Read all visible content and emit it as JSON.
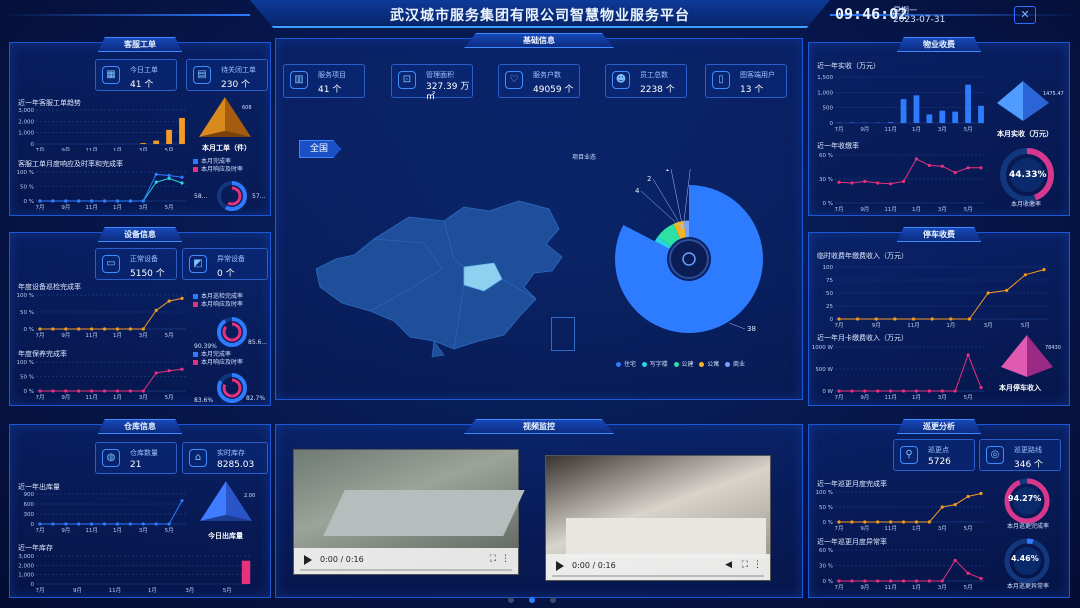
{
  "header": {
    "title": "武汉城市服务集团有限公司智慧物业服务平台",
    "clock": "09:46:02",
    "weekday": "星期一",
    "date": "2023-07-31"
  },
  "colors": {
    "accent": "#2d7bff",
    "orange": "#f59a23",
    "pink": "#e8317d",
    "cyan": "#29d5e0"
  },
  "service_orders": {
    "title": "客服工单",
    "today_label": "今日工单",
    "today_value": "41 个",
    "pending_label": "待关闭工单",
    "pending_value": "230 个",
    "trend_title": "近一年客服工单趋势",
    "rate_title": "客服工单月度响应及时率和完成率",
    "legend_done": "本月完成率",
    "legend_resp": "本月响应及时率",
    "pyramid_value": "608",
    "pyramid_label": "本月工单（件）",
    "donut_left": "58...",
    "donut_right": "57..."
  },
  "devices": {
    "title": "设备信息",
    "normal_label": "正常设备",
    "normal_value": "5150 个",
    "abnormal_label": "异常设备",
    "abnormal_value": "0 个",
    "inspect_title": "年度设备巡检完成率",
    "maintain_title": "年度保养完成率",
    "legend_inspect": "本月巡检完成率",
    "legend_inspect_resp": "本月响应及时率",
    "legend_maint": "本月完成率",
    "legend_maint_resp": "本月响应及时率",
    "donut1_left": "90.39%",
    "donut1_right": "85.6...",
    "donut2_left": "83.6%",
    "donut2_right": "82.7%"
  },
  "warehouse": {
    "title": "仓库信息",
    "count_label": "仓库数量",
    "count_value": "21",
    "stock_label": "实时库存",
    "stock_value": "8285.03",
    "out_title": "近一年出库量",
    "stock_title": "近一年库存",
    "pyramid_value": "2.00",
    "pyramid_label": "今日出库量"
  },
  "base_info": {
    "title": "基础信息",
    "cards": [
      {
        "label": "服务项目",
        "value": "41 个",
        "icon": "building-icon"
      },
      {
        "label": "管理面积",
        "value": "327.39 万 ㎡",
        "icon": "area-icon"
      },
      {
        "label": "服务户数",
        "value": "49059 个",
        "icon": "heart-icon"
      },
      {
        "label": "员工总数",
        "value": "2238 个",
        "icon": "people-icon"
      },
      {
        "label": "图客端用户",
        "value": "13 个",
        "icon": "phone-icon"
      }
    ],
    "map_button": "全国",
    "pie_title": "项目业态",
    "pie_legend": [
      "住宅",
      "写字楼",
      "公建",
      "公寓",
      "商业"
    ],
    "pie_callouts": [
      "1",
      "2",
      "4",
      "1",
      "38"
    ]
  },
  "video": {
    "title": "视频监控",
    "time": "0:00 / 0:16"
  },
  "property_fee": {
    "title": "物业收费",
    "collected_title": "近一年实收（万元）",
    "rate_title": "近一年收缴率",
    "pyramid_value": "1475.47",
    "pyramid_label": "本月实收（万元）",
    "gauge_value": "44.33%",
    "gauge_label": "本月收缴率"
  },
  "parking": {
    "title": "停车收费",
    "temp_title": "临时收费年缴费收入（万元）",
    "card_title": "近一年月卡缴费收入（万元）",
    "pyramid_value": "78430",
    "pyramid_label": "本月停车收入"
  },
  "patrol": {
    "title": "巡更分析",
    "points_label": "巡更点",
    "points_value": "5726",
    "routes_label": "巡更路线",
    "routes_value": "346 个",
    "done_title": "近一年巡更月度完成率",
    "abnormal_title": "近一年巡更月度异常率",
    "gauge1_value": "94.27%",
    "gauge1_label": "本月巡更完成率",
    "gauge2_value": "4.46%",
    "gauge2_label": "本月巡更异常率"
  },
  "chart_data": [
    {
      "type": "bar",
      "title": "近一年客服工单趋势",
      "categories": [
        "7月",
        "8月",
        "9月",
        "10月",
        "11月",
        "12月",
        "1月",
        "2月",
        "3月",
        "4月",
        "5月",
        "6月"
      ],
      "values": [
        0,
        0,
        0,
        0,
        0,
        0,
        0,
        0,
        80,
        300,
        1250,
        2300
      ],
      "ylim": [
        0,
        3000
      ],
      "yticks": [
        "0",
        "1,000",
        "2,000",
        "3,000"
      ],
      "xticks": [
        "7月",
        "9月",
        "11月",
        "1月",
        "3月",
        "5月"
      ]
    },
    {
      "type": "line",
      "title": "客服工单月度响应及时率和完成率",
      "categories": [
        "7月",
        "8月",
        "9月",
        "10月",
        "11月",
        "12月",
        "1月",
        "2月",
        "3月",
        "4月",
        "5月",
        "6月"
      ],
      "series": [
        {
          "name": "本月完成率",
          "values": [
            0,
            0,
            0,
            0,
            0,
            0,
            0,
            0,
            0,
            65,
            78,
            62
          ]
        },
        {
          "name": "本月响应及时率",
          "values": [
            0,
            0,
            0,
            0,
            0,
            0,
            0,
            0,
            0,
            92,
            88,
            82
          ]
        }
      ],
      "ylim": [
        0,
        100
      ],
      "yticks": [
        "0 %",
        "50 %",
        "100 %"
      ],
      "xticks": [
        "7月",
        "9月",
        "11月",
        "1月",
        "3月",
        "5月"
      ]
    },
    {
      "type": "line",
      "title": "年度设备巡检完成率",
      "categories": [
        "7月",
        "8月",
        "9月",
        "10月",
        "11月",
        "12月",
        "1月",
        "2月",
        "3月",
        "4月",
        "5月",
        "6月"
      ],
      "series": [
        {
          "name": "本月巡检完成率",
          "values": [
            0,
            0,
            0,
            0,
            0,
            0,
            0,
            0,
            0,
            55,
            82,
            90
          ]
        }
      ],
      "ylim": [
        0,
        100
      ],
      "yticks": [
        "0 %",
        "50 %",
        "100 %"
      ],
      "xticks": [
        "7月",
        "9月",
        "11月",
        "1月",
        "3月",
        "5月"
      ]
    },
    {
      "type": "line",
      "title": "年度保养完成率",
      "categories": [
        "7月",
        "8月",
        "9月",
        "10月",
        "11月",
        "12月",
        "1月",
        "2月",
        "3月",
        "4月",
        "5月",
        "6月"
      ],
      "series": [
        {
          "name": "本月完成率",
          "values": [
            0,
            0,
            0,
            0,
            0,
            0,
            0,
            0,
            0,
            62,
            70,
            75
          ]
        }
      ],
      "ylim": [
        0,
        100
      ],
      "yticks": [
        "0 %",
        "50 %",
        "100 %"
      ],
      "xticks": [
        "7月",
        "9月",
        "11月",
        "1月",
        "3月",
        "5月"
      ]
    },
    {
      "type": "line",
      "title": "近一年出库量",
      "categories": [
        "7月",
        "8月",
        "9月",
        "10月",
        "11月",
        "12月",
        "1月",
        "2月",
        "3月",
        "4月",
        "5月",
        "6月"
      ],
      "series": [
        {
          "name": "出库量",
          "values": [
            0,
            0,
            0,
            0,
            0,
            0,
            0,
            0,
            0,
            0,
            0,
            700
          ]
        }
      ],
      "ylim": [
        0,
        900
      ],
      "yticks": [
        "0",
        "300",
        "600",
        "900"
      ],
      "xticks": [
        "7月",
        "9月",
        "11月",
        "1月",
        "3月",
        "5月"
      ]
    },
    {
      "type": "bar",
      "title": "近一年库存",
      "categories": [
        "7月",
        "8月",
        "9月",
        "10月",
        "11月",
        "12月",
        "1月",
        "2月",
        "3月",
        "4月",
        "5月",
        "6月"
      ],
      "values": [
        0,
        0,
        0,
        0,
        0,
        0,
        0,
        0,
        0,
        0,
        0,
        2500
      ],
      "ylim": [
        0,
        3000
      ],
      "yticks": [
        "0",
        "1,000",
        "2,000",
        "3,000"
      ],
      "xticks": [
        "7月",
        "9月",
        "11月",
        "1月",
        "3月",
        "5月"
      ]
    },
    {
      "type": "pie",
      "title": "项目业态",
      "categories": [
        "住宅",
        "写字楼",
        "公建",
        "公寓",
        "商业"
      ],
      "values": [
        38,
        1,
        4,
        2,
        1
      ]
    },
    {
      "type": "bar",
      "title": "近一年实收（万元）",
      "categories": [
        "7月",
        "8月",
        "9月",
        "10月",
        "11月",
        "12月",
        "1月",
        "2月",
        "3月",
        "4月",
        "5月",
        "6月"
      ],
      "values": [
        10,
        15,
        10,
        12,
        25,
        780,
        900,
        280,
        400,
        370,
        1250,
        560
      ],
      "ylim": [
        0,
        1500
      ],
      "yticks": [
        "0",
        "500",
        "1,000",
        "1,500"
      ],
      "xticks": [
        "7月",
        "9月",
        "11月",
        "1月",
        "3月",
        "5月"
      ]
    },
    {
      "type": "line",
      "title": "近一年收缴率",
      "categories": [
        "7月",
        "8月",
        "9月",
        "10月",
        "11月",
        "12月",
        "1月",
        "2月",
        "3月",
        "4月",
        "5月",
        "6月"
      ],
      "series": [
        {
          "name": "收缴率",
          "values": [
            26,
            25,
            27,
            25,
            24,
            27,
            55,
            47,
            46,
            38,
            44,
            44
          ]
        }
      ],
      "ylim": [
        0,
        60
      ],
      "yticks": [
        "0 %",
        "30 %",
        "60 %"
      ],
      "xticks": [
        "7月",
        "9月",
        "11月",
        "1月",
        "3月",
        "5月"
      ]
    },
    {
      "type": "line",
      "title": "临时收费年缴费收入（万元）",
      "categories": [
        "7月",
        "8月",
        "9月",
        "10月",
        "11月",
        "12月",
        "1月",
        "2月",
        "3月",
        "4月",
        "5月",
        "6月"
      ],
      "series": [
        {
          "name": "临时收费",
          "values": [
            0,
            0,
            0,
            0,
            0,
            0,
            0,
            0,
            50,
            55,
            85,
            95
          ]
        }
      ],
      "ylim": [
        0,
        100
      ],
      "yticks": [
        "0",
        "25",
        "50",
        "75",
        "100"
      ],
      "xticks": [
        "7月",
        "9月",
        "11月",
        "1月",
        "3月",
        "5月"
      ]
    },
    {
      "type": "line",
      "title": "近一年月卡缴费收入（万元）",
      "categories": [
        "7月",
        "8月",
        "9月",
        "10月",
        "11月",
        "12月",
        "1月",
        "2月",
        "3月",
        "4月",
        "5月",
        "6月"
      ],
      "series": [
        {
          "name": "月卡",
          "values": [
            0,
            0,
            0,
            0,
            0,
            0,
            0,
            0,
            0,
            0,
            820,
            80
          ]
        }
      ],
      "ylim": [
        0,
        1000
      ],
      "yticks": [
        "0 W",
        "500 W",
        "1000 W"
      ],
      "xticks": [
        "7月",
        "9月",
        "11月",
        "1月",
        "3月",
        "5月"
      ]
    },
    {
      "type": "line",
      "title": "近一年巡更月度完成率",
      "categories": [
        "7月",
        "8月",
        "9月",
        "10月",
        "11月",
        "12月",
        "1月",
        "2月",
        "3月",
        "4月",
        "5月",
        "6月"
      ],
      "series": [
        {
          "name": "完成率",
          "values": [
            0,
            0,
            0,
            0,
            0,
            0,
            0,
            0,
            50,
            58,
            85,
            95
          ]
        }
      ],
      "ylim": [
        0,
        100
      ],
      "yticks": [
        "0 %",
        "50 %",
        "100 %"
      ],
      "xticks": [
        "7月",
        "9月",
        "11月",
        "1月",
        "3月",
        "5月"
      ]
    },
    {
      "type": "line",
      "title": "近一年巡更月度异常率",
      "categories": [
        "7月",
        "8月",
        "9月",
        "10月",
        "11月",
        "12月",
        "1月",
        "2月",
        "3月",
        "4月",
        "5月",
        "6月"
      ],
      "series": [
        {
          "name": "异常率",
          "values": [
            0,
            0,
            0,
            0,
            0,
            0,
            0,
            0,
            0,
            40,
            15,
            5
          ]
        }
      ],
      "ylim": [
        0,
        60
      ],
      "yticks": [
        "0 %",
        "30 %",
        "60 %"
      ],
      "xticks": [
        "7月",
        "9月",
        "11月",
        "1月",
        "3月",
        "5月"
      ]
    }
  ]
}
